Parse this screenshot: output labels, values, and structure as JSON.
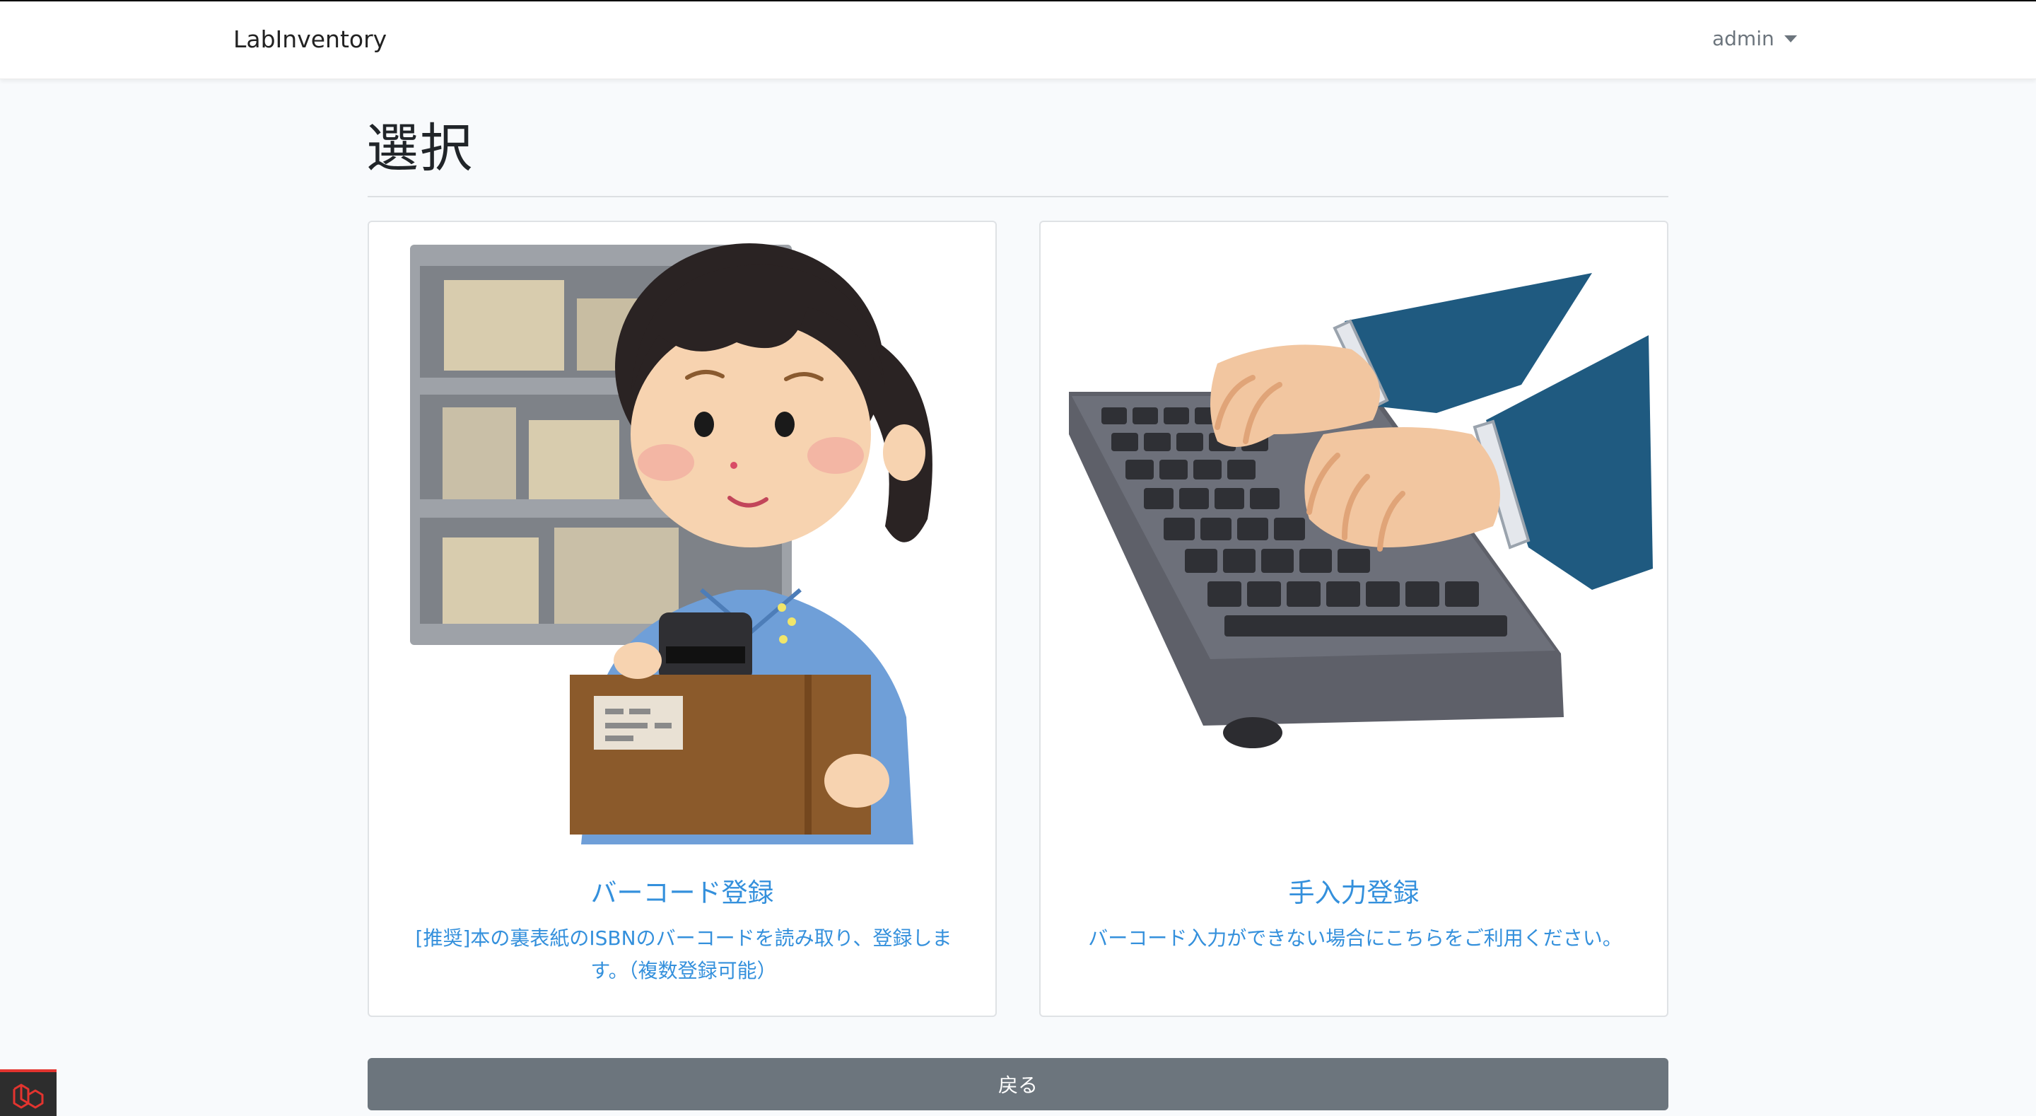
{
  "nav": {
    "brand": "LabInventory",
    "user": "admin"
  },
  "page": {
    "title": "選択"
  },
  "cards": [
    {
      "title": "バーコード登録",
      "desc_line1": "[推奨]本の裏表紙のISBNのバーコードを読み取り、登録しま",
      "desc_line2": "す。（複数登録可能）",
      "icon": "barcode-scanner-illustration"
    },
    {
      "title": "手入力登録",
      "desc_line1": "バーコード入力ができない場合にこちらをご利用ください。",
      "icon": "keyboard-typing-illustration"
    }
  ],
  "actions": {
    "back_label": "戻る"
  },
  "colors": {
    "link": "#3490dc",
    "secondary": "#6c757d",
    "background": "#f8fafc"
  }
}
